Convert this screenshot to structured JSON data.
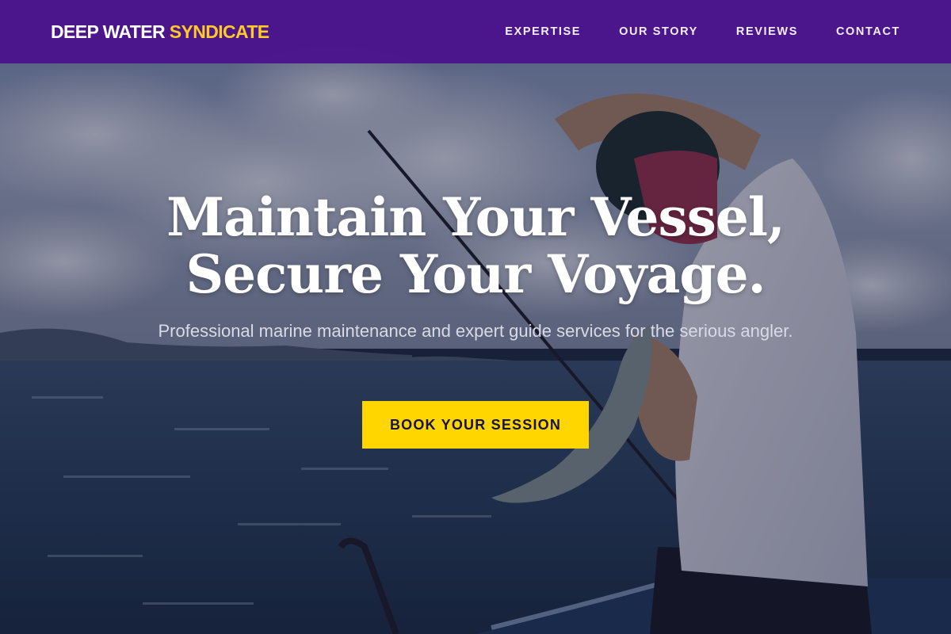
{
  "navbar": {
    "brand_primary": "DEEP WATER",
    "brand_accent": "SYNDICATE",
    "links": [
      {
        "label": "EXPERTISE"
      },
      {
        "label": "OUR STORY"
      },
      {
        "label": "REVIEWS"
      },
      {
        "label": "CONTACT"
      }
    ]
  },
  "hero": {
    "title_line_1": "Maintain Your Vessel,",
    "title_line_2": "Secure Your Voyage.",
    "subtitle": "Professional marine maintenance and expert guide services for the serious angler.",
    "cta_label": "BOOK YOUR SESSION",
    "background_image": "angler on a boat holding a fish with a fishing rod over the sea"
  },
  "colors": {
    "navbar_bg": "#4a108c",
    "brand_accent": "#ffc928",
    "cta_bg": "#ffd600",
    "cta_text": "#16124a"
  }
}
